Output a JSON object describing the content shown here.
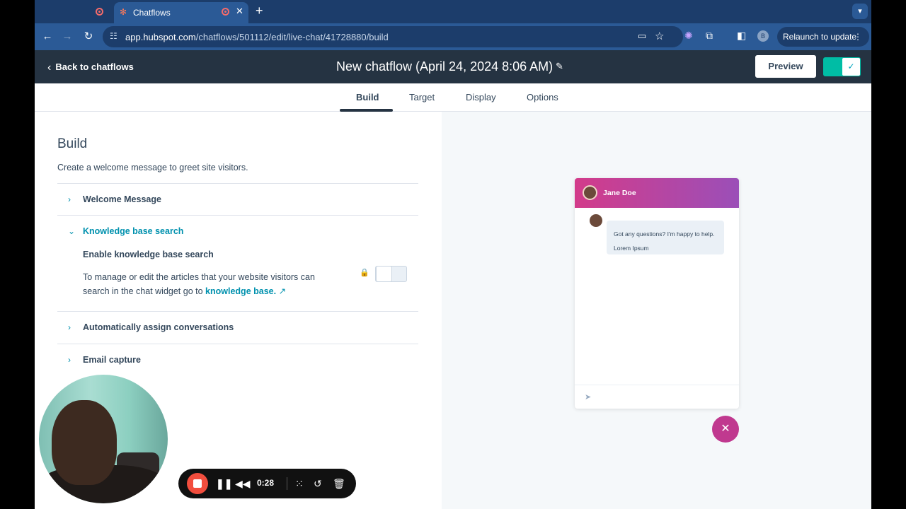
{
  "browser": {
    "tab_title": "Chatflows",
    "new_tab": "+",
    "url_host": "app.hubspot.com",
    "url_path": "/chatflows/501112/edit/live-chat/41728880/build",
    "profile_initial": "B",
    "relaunch_label": "Relaunch to update"
  },
  "header": {
    "back_label": "Back to chatflows",
    "title": "New chatflow (April 24, 2024 8:06 AM)",
    "preview_label": "Preview"
  },
  "tabs": [
    "Build",
    "Target",
    "Display",
    "Options"
  ],
  "build": {
    "heading": "Build",
    "subtitle": "Create a welcome message to greet site visitors.",
    "sections": [
      "Welcome Message",
      "Knowledge base search",
      "Automatically assign conversations",
      "Email capture"
    ],
    "kb": {
      "title": "Enable knowledge base search",
      "desc": "To manage or edit the articles that your website visitors can search in the chat widget go to",
      "link": "knowledge base."
    }
  },
  "preview": {
    "agent_name": "Jane Doe",
    "message_1": "Got any questions? I'm happy to help.",
    "message_2": "Lorem Ipsum"
  },
  "recorder": {
    "time": "0:28"
  },
  "colors": {
    "hubspot_header": "#253342",
    "accent_teal": "#0091ae",
    "chat_gradient_start": "#d33b8a",
    "chat_gradient_end": "#9b4fb8",
    "record_red": "#f24e3e"
  }
}
